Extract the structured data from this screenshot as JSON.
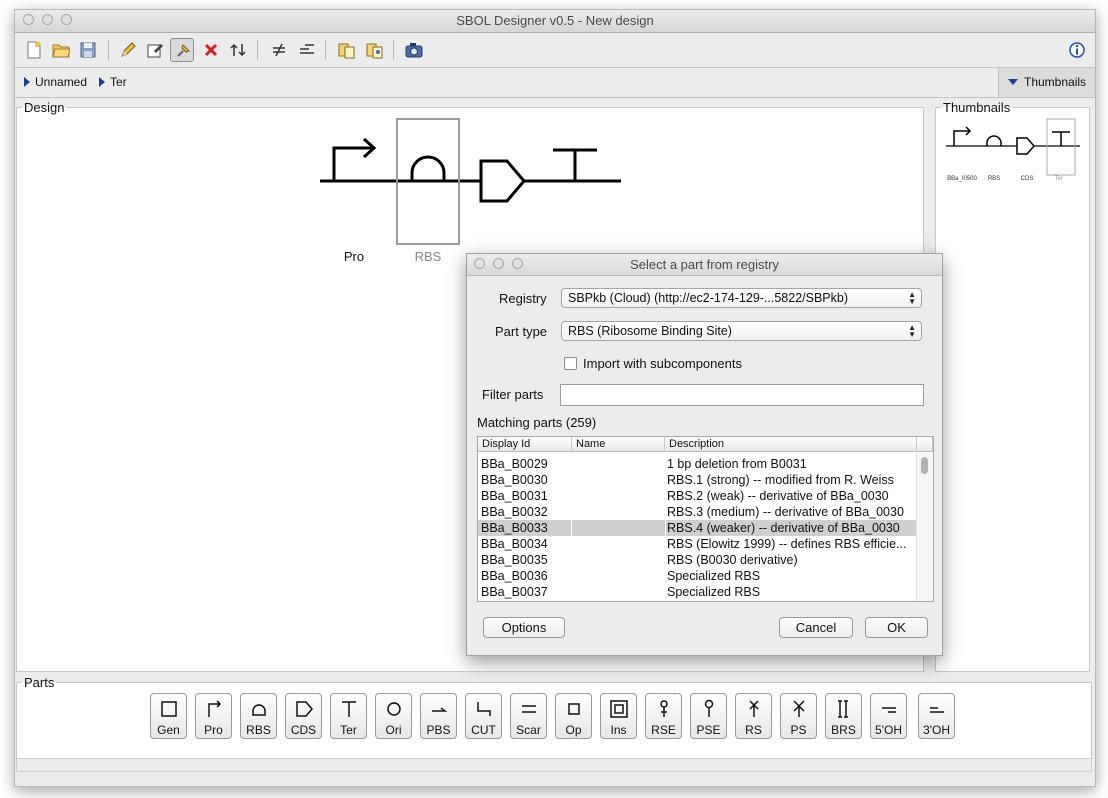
{
  "window": {
    "title": "SBOL Designer v0.5 - New design"
  },
  "toolbar": {
    "icons": [
      "new-document-icon",
      "open-folder-icon",
      "save-icon",
      "edit-pencil-icon",
      "edit-properties-icon",
      "focus-pin-icon",
      "delete-x-icon",
      "flip-arrows-icon",
      "hide-scars-icon",
      "add-scars-icon",
      "import-icon",
      "export-icon",
      "snapshot-camera-icon",
      "info-icon"
    ]
  },
  "breadcrumb": {
    "items": [
      "Unnamed",
      "Ter"
    ],
    "thumbnails_toggle": "Thumbnails"
  },
  "design": {
    "panel_title": "Design",
    "parts": [
      {
        "type": "Pro",
        "label": "Pro"
      },
      {
        "type": "RBS",
        "label": "RBS"
      },
      {
        "type": "CDS",
        "label": ""
      },
      {
        "type": "Ter",
        "label": ""
      }
    ]
  },
  "thumbnails": {
    "panel_title": "Thumbnails",
    "labels": [
      "BBa_I0500",
      "RBS",
      "CDS",
      "Ter"
    ]
  },
  "parts_panel": {
    "title": "Parts",
    "buttons": [
      "Gen",
      "Pro",
      "RBS",
      "CDS",
      "Ter",
      "Ori",
      "PBS",
      "CUT",
      "Scar",
      "Op",
      "Ins",
      "RSE",
      "PSE",
      "RS",
      "PS",
      "BRS",
      "5'OH",
      "3'OH"
    ]
  },
  "dialog": {
    "title": "Select a part from registry",
    "registry_label": "Registry",
    "registry_value": "SBPkb (Cloud) (http://ec2-174-129-...5822/SBPkb)",
    "part_type_label": "Part type",
    "part_type_value": "RBS (Ribosome Binding Site)",
    "import_sub_label": "Import with subcomponents",
    "import_sub_checked": false,
    "filter_label": "Filter parts",
    "filter_value": "",
    "matching_label": "Matching parts (259)",
    "columns": [
      "Display Id",
      "Name",
      "Description"
    ],
    "rows": [
      {
        "id": "BBa_B0029",
        "name": "",
        "desc": "1 bp deletion from B0031"
      },
      {
        "id": "BBa_B0030",
        "name": "",
        "desc": "RBS.1 (strong) -- modified from R. Weiss"
      },
      {
        "id": "BBa_B0031",
        "name": "",
        "desc": "RBS.2 (weak) -- derivative of BBa_0030"
      },
      {
        "id": "BBa_B0032",
        "name": "",
        "desc": "RBS.3 (medium) -- derivative of BBa_0030"
      },
      {
        "id": "BBa_B0033",
        "name": "",
        "desc": "RBS.4 (weaker) -- derivative of BBa_0030"
      },
      {
        "id": "BBa_B0034",
        "name": "",
        "desc": "RBS (Elowitz 1999) -- defines RBS efficie..."
      },
      {
        "id": "BBa_B0035",
        "name": "",
        "desc": "RBS (B0030 derivative)"
      },
      {
        "id": "BBa_B0036",
        "name": "",
        "desc": "Specialized RBS"
      },
      {
        "id": "BBa_B0037",
        "name": "",
        "desc": "Specialized RBS"
      }
    ],
    "selected_row": 4,
    "options_button": "Options",
    "cancel_button": "Cancel",
    "ok_button": "OK"
  }
}
